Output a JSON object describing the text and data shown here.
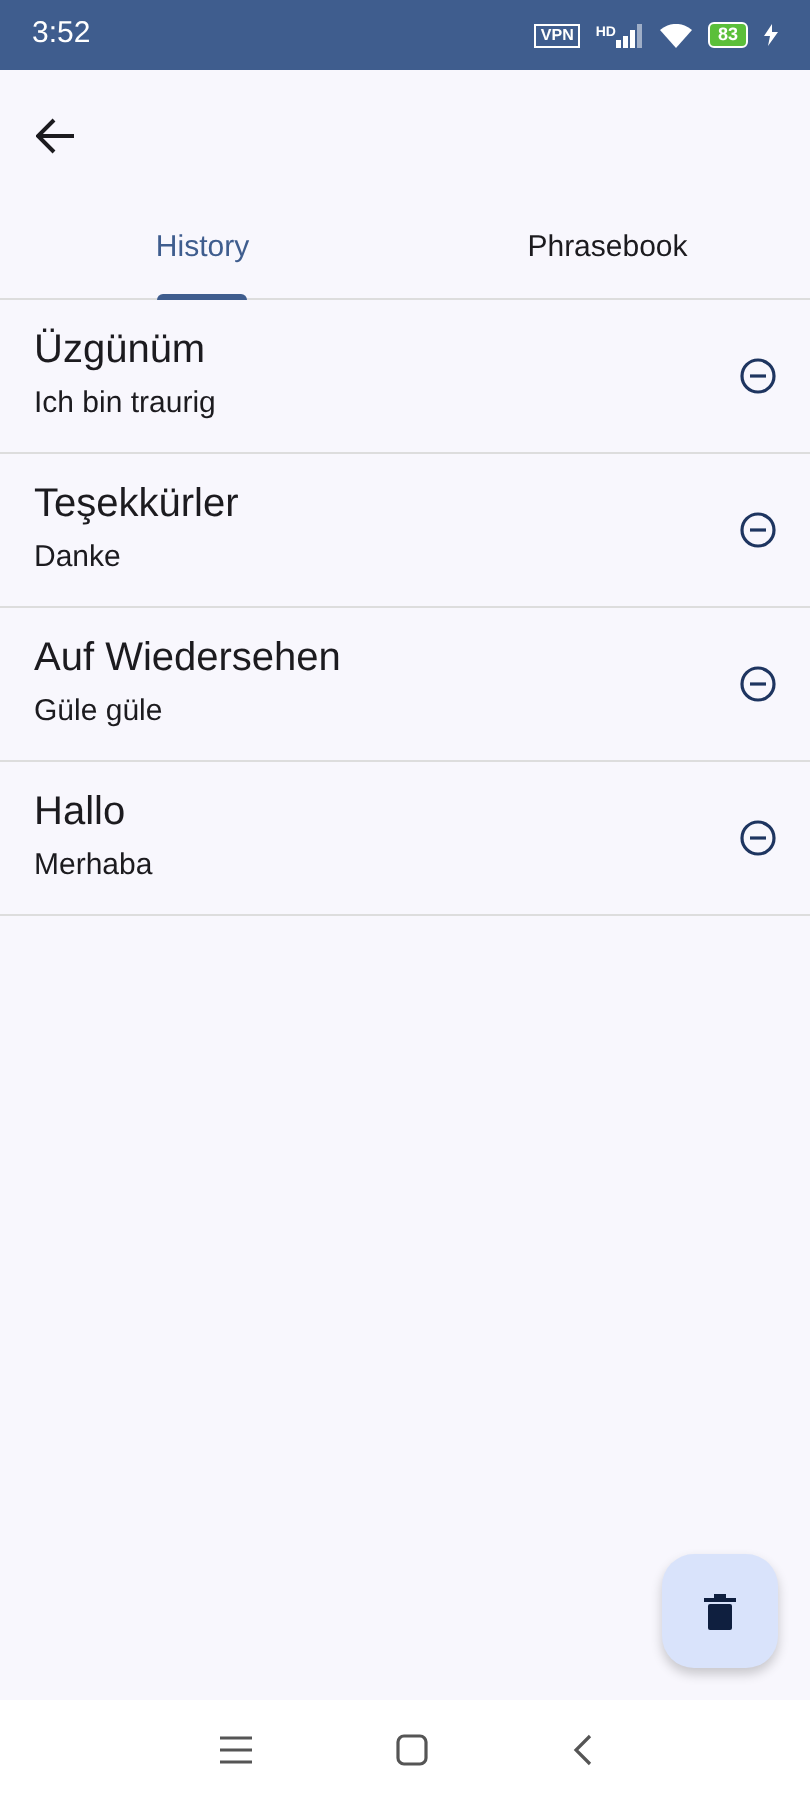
{
  "status_bar": {
    "time": "3:52",
    "vpn": "VPN",
    "network": "HD",
    "battery": "83"
  },
  "tabs": [
    {
      "label": "History",
      "selected": true
    },
    {
      "label": "Phrasebook",
      "selected": false
    }
  ],
  "entries": [
    {
      "title": "Üzgünüm",
      "subtitle": "Ich bin traurig"
    },
    {
      "title": "Teşekkürler",
      "subtitle": "Danke"
    },
    {
      "title": "Auf Wiedersehen",
      "subtitle": "Güle güle"
    },
    {
      "title": "Hallo",
      "subtitle": "Merhaba"
    }
  ]
}
